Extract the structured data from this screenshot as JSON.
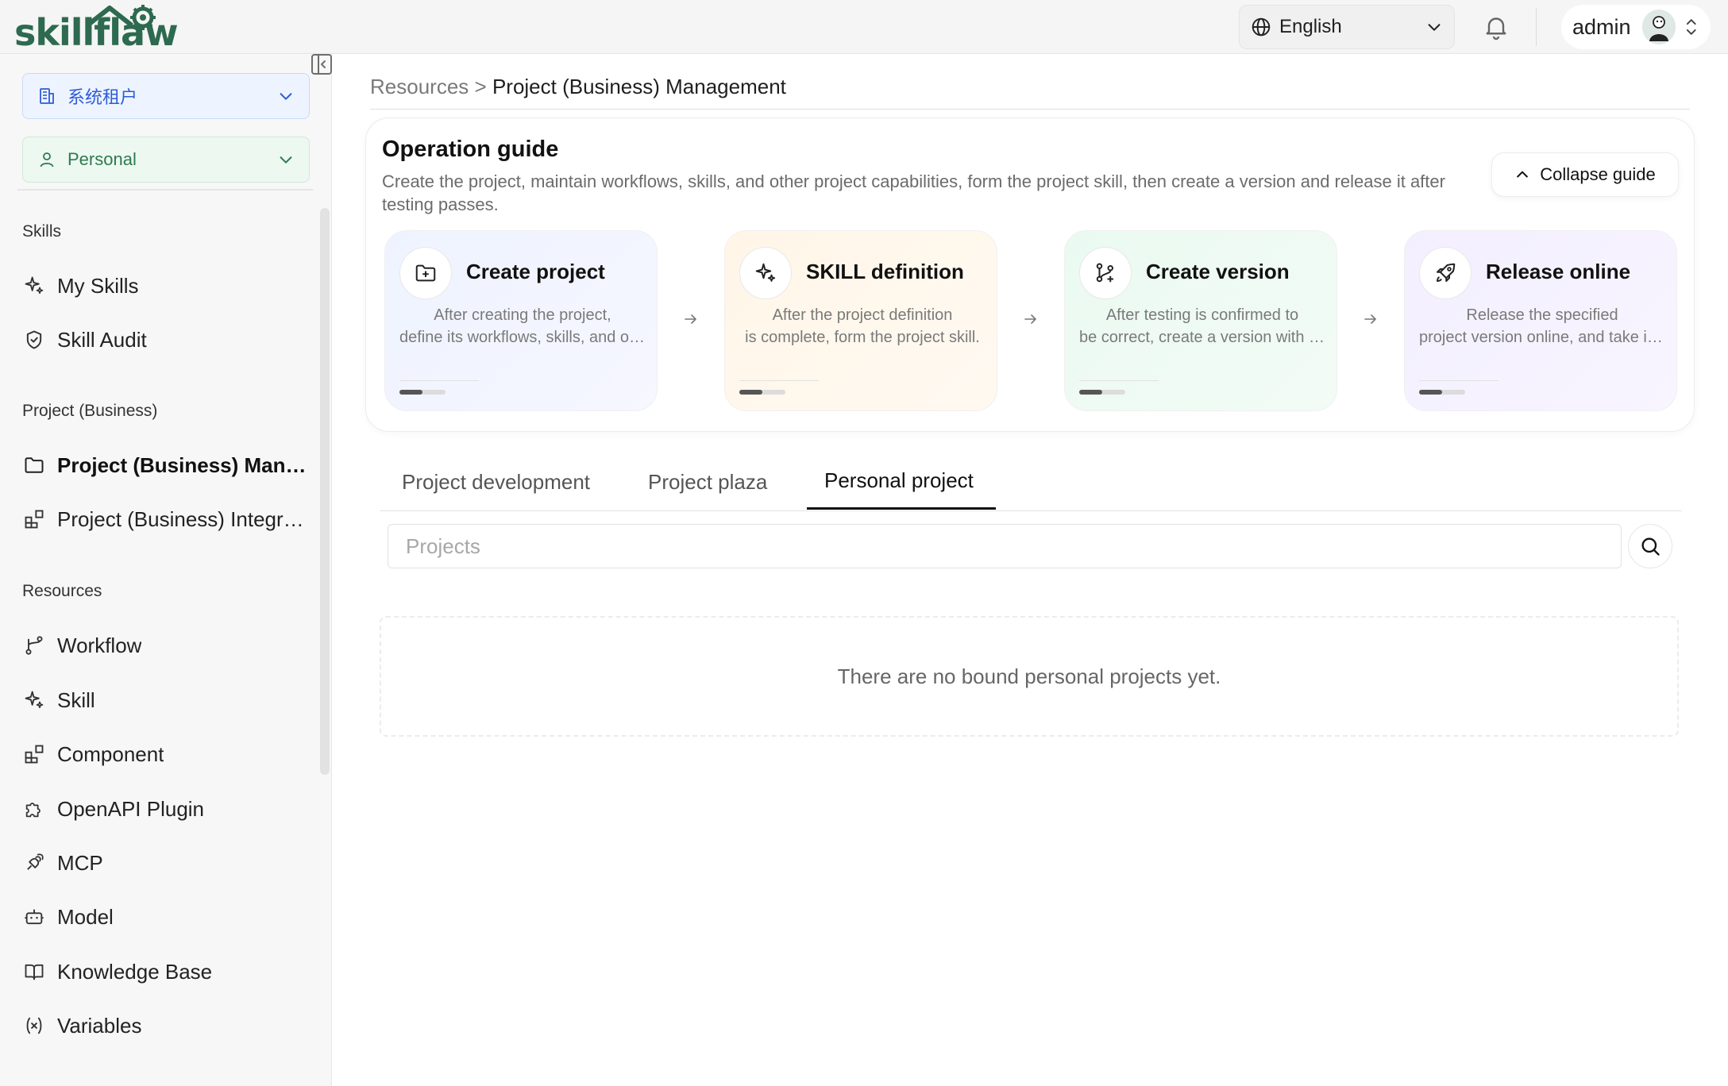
{
  "app": {
    "logo_text": "skillflaw"
  },
  "topbar": {
    "language": "English",
    "user_name": "admin"
  },
  "sidebar": {
    "tenant_select": "系统租户",
    "scope_select": "Personal",
    "sections": [
      {
        "title": "Skills",
        "items": [
          {
            "label": "My Skills",
            "icon": "sparkle-icon"
          },
          {
            "label": "Skill Audit",
            "icon": "shield-check-icon"
          }
        ]
      },
      {
        "title": "Project (Business)",
        "items": [
          {
            "label": "Project (Business) Management",
            "icon": "folder-icon",
            "active": true
          },
          {
            "label": "Project (Business) Integration",
            "icon": "blocks-icon"
          }
        ]
      },
      {
        "title": "Resources",
        "items": [
          {
            "label": "Workflow",
            "icon": "workflow-icon"
          },
          {
            "label": "Skill",
            "icon": "sparkle-icon"
          },
          {
            "label": "Component",
            "icon": "blocks-icon"
          },
          {
            "label": "OpenAPI Plugin",
            "icon": "puzzle-icon"
          },
          {
            "label": "MCP",
            "icon": "plug-icon"
          },
          {
            "label": "Model",
            "icon": "bot-icon"
          },
          {
            "label": "Knowledge Base",
            "icon": "book-icon"
          },
          {
            "label": "Variables",
            "icon": "variable-icon"
          }
        ]
      }
    ]
  },
  "breadcrumb": {
    "parent": "Resources",
    "separator": ">",
    "current": "Project (Business) Management"
  },
  "guide": {
    "title": "Operation guide",
    "description": "Create the project, maintain workflows, skills, and other project capabilities, form the project skill, then create a version and release it after testing passes.",
    "collapse_label": "Collapse guide",
    "steps": [
      {
        "title": "Create project",
        "desc_line1": "After creating the project,",
        "desc_line2": "define its workflows, skills, and other capabilities.",
        "icon": "folder-plus-icon",
        "progress": 0.5
      },
      {
        "title": "SKILL definition",
        "desc_line1": "After the project definition",
        "desc_line2": "is complete, form the project skill.",
        "icon": "sparkle-icon",
        "progress": 0.5
      },
      {
        "title": "Create version",
        "desc_line1": "After testing is confirmed to",
        "desc_line2": "be correct, create a version with the project.",
        "icon": "git-branch-plus-icon",
        "progress": 0.5
      },
      {
        "title": "Release online",
        "desc_line1": "Release the specified",
        "desc_line2": "project version online, and take it into effect.",
        "icon": "rocket-icon",
        "progress": 0.5
      }
    ]
  },
  "tabs": [
    {
      "label": "Project development",
      "active": false
    },
    {
      "label": "Project plaza",
      "active": false
    },
    {
      "label": "Personal project",
      "active": true
    }
  ],
  "search": {
    "placeholder": "Projects",
    "value": ""
  },
  "empty_state": "There are no bound personal projects yet.",
  "colors": {
    "brand": "#2d6a4f",
    "tenant_accent": "#2f5bd8",
    "personal_accent": "#2f7a4e"
  }
}
